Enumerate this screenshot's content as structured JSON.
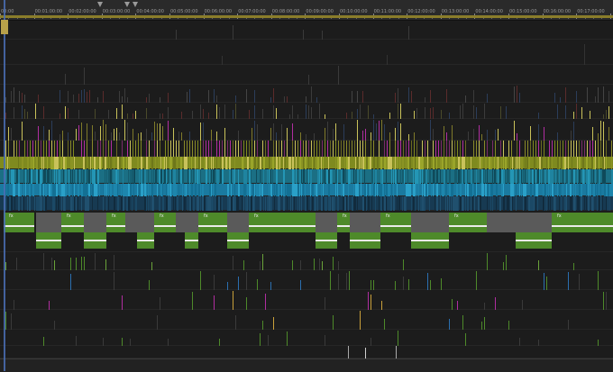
{
  "ruler": {
    "timecodes": [
      "00:00",
      "00:01:00:00",
      "00:02:00:00",
      "00:03:00:00",
      "00:04:00:00",
      "00:05:00:00",
      "00:06:00:00",
      "00:07:00:00",
      "00:08:00:00",
      "00:09:00:00",
      "00:10:00:00",
      "00:11:00:00",
      "00:12:00:00",
      "00:13:00:00",
      "00:14:00:00",
      "00:15:00:00",
      "00:16:00:00",
      "00:17:00:00"
    ]
  },
  "colors": {
    "background": "#1c1c1c",
    "ruler": "#2a2a2a",
    "work_area": "#8a7d2a",
    "playhead": "#4a6fb5",
    "video_clip_green": "#4e8a2a",
    "gap": "#5a5a5a",
    "olive_track": "#7f8a1f",
    "teal_track": "#1b6f84",
    "navy_track": "#173a52",
    "magenta_mark": "#b02ea0",
    "yellow_mark": "#c9c25a"
  },
  "icons": {
    "effect_badge": "fx-icon",
    "marker": "marker-icon",
    "playhead": "playhead-icon"
  },
  "effect_badge_text": "fx"
}
